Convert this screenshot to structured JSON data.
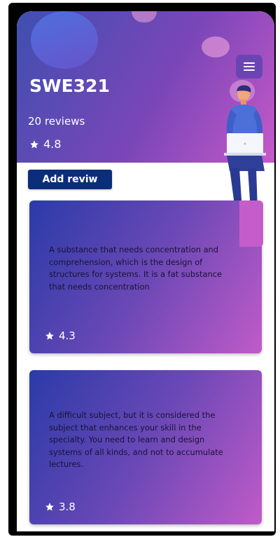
{
  "course": {
    "title": "SWE321",
    "reviews_count": "20 reviews",
    "rating": "4.8"
  },
  "actions": {
    "add_review_label": "Add reviw"
  },
  "reviews": [
    {
      "text": "A substance that needs concentration and comprehension, which is the design of structures for systems. It is a fat substance that needs concentration",
      "rating": "4.3"
    },
    {
      "text": "A difficult subject, but it is considered the subject that enhances your skill in the specialty. You need to learn and design systems of all kinds, and not to accumulate lectures.",
      "rating": "3.8"
    }
  ],
  "icons": {
    "menu": "menu-icon",
    "star": "star-icon",
    "illustration": "person-with-laptop-illustration"
  },
  "colors": {
    "header_start": "#3f4fb0",
    "header_end": "#c659c8",
    "button": "#0c2d7a",
    "text_on_card": "#1a1236"
  }
}
